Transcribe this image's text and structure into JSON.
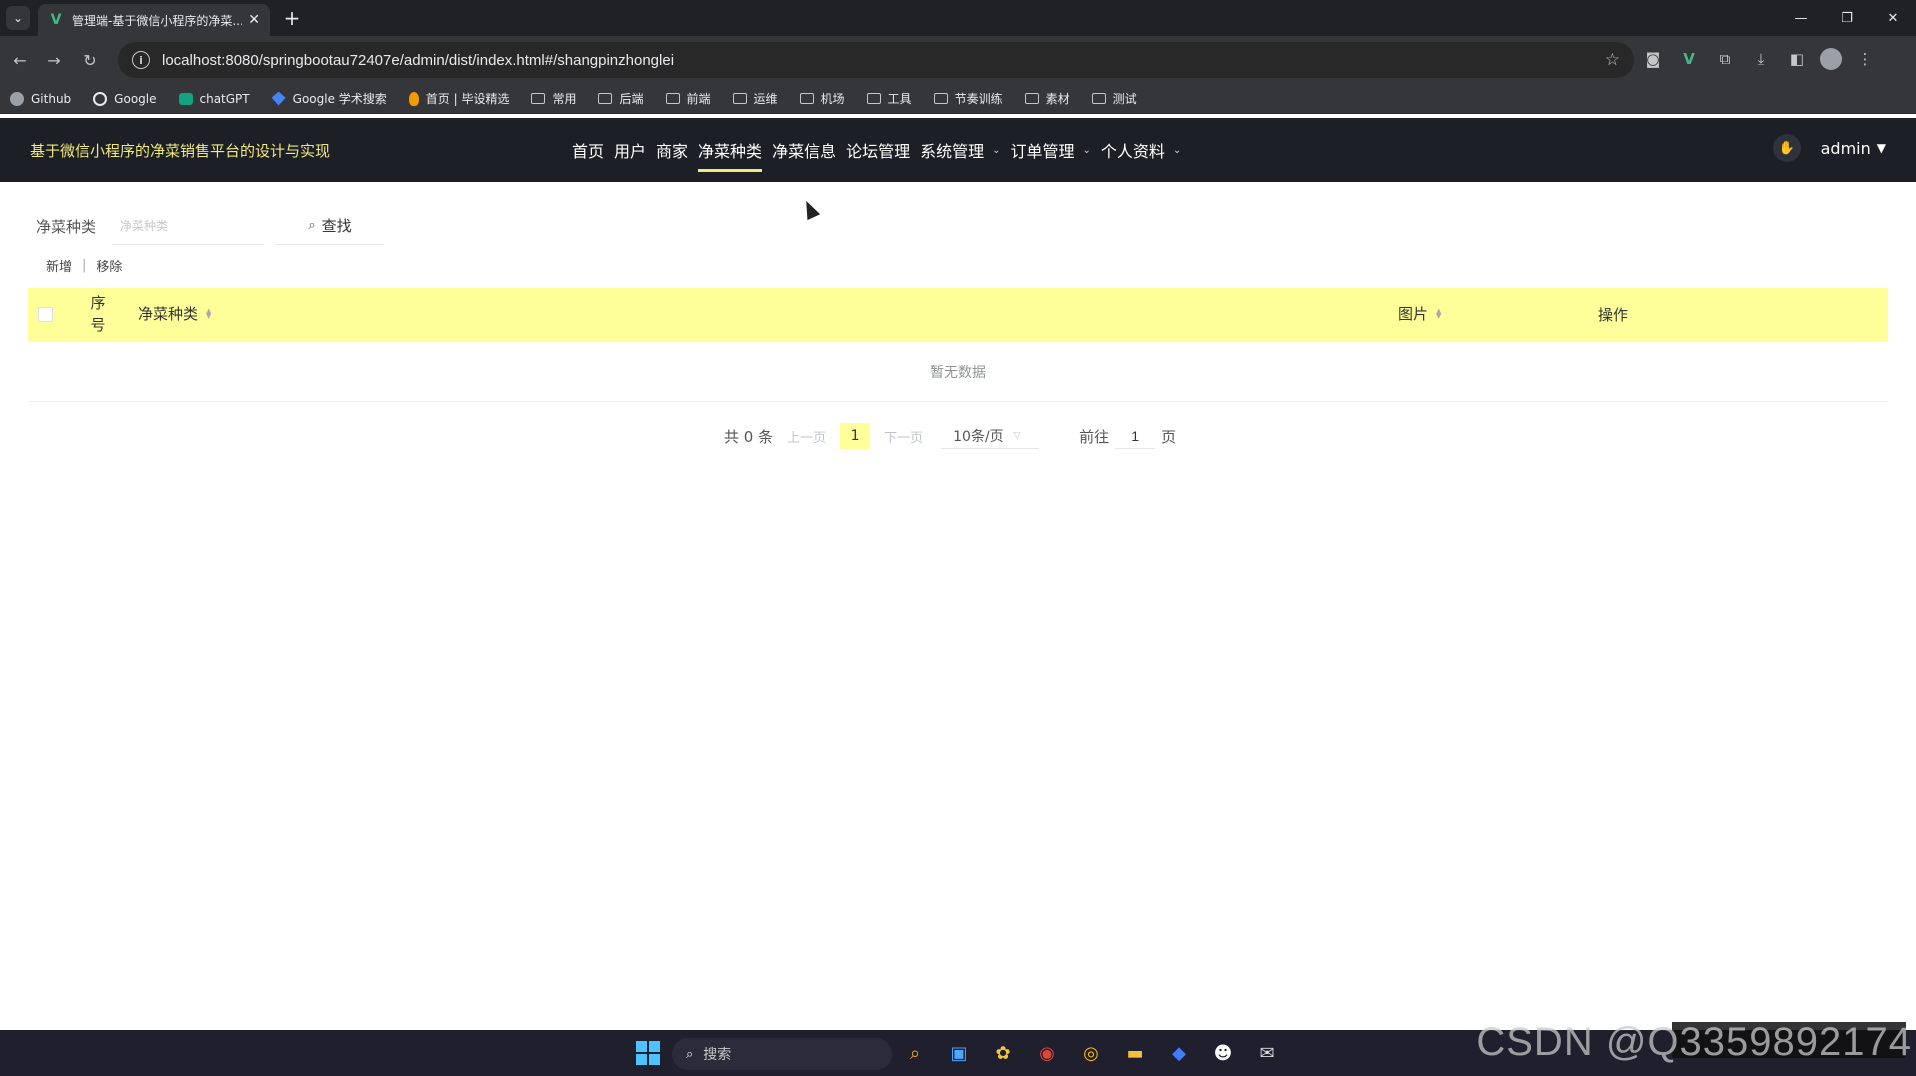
{
  "browser": {
    "tab_title": "管理端-基于微信小程序的净菜...",
    "tab_favicon": "V",
    "url": "localhost:8080/springbootau72407e/admin/dist/index.html#/shangpinzhonglei",
    "bookmarks": [
      {
        "label": "Github",
        "icon": "circle"
      },
      {
        "label": "Google",
        "icon": "g"
      },
      {
        "label": "chatGPT",
        "icon": "gpt"
      },
      {
        "label": "Google 学术搜索",
        "icon": "scholar"
      },
      {
        "label": "首页 | 毕设精选",
        "icon": "fire"
      },
      {
        "label": "常用",
        "icon": "folder"
      },
      {
        "label": "后端",
        "icon": "folder"
      },
      {
        "label": "前端",
        "icon": "folder"
      },
      {
        "label": "运维",
        "icon": "folder"
      },
      {
        "label": "机场",
        "icon": "folder"
      },
      {
        "label": "工具",
        "icon": "folder"
      },
      {
        "label": "节奏训练",
        "icon": "folder"
      },
      {
        "label": "素材",
        "icon": "folder"
      },
      {
        "label": "测试",
        "icon": "folder"
      }
    ]
  },
  "header": {
    "title": "基于微信小程序的净菜销售平台的设计与实现",
    "nav": [
      {
        "label": "首页",
        "active": false,
        "dropdown": false
      },
      {
        "label": "用户",
        "active": false,
        "dropdown": false
      },
      {
        "label": "商家",
        "active": false,
        "dropdown": false
      },
      {
        "label": "净菜种类",
        "active": true,
        "dropdown": false
      },
      {
        "label": "净菜信息",
        "active": false,
        "dropdown": false
      },
      {
        "label": "论坛管理",
        "active": false,
        "dropdown": false
      },
      {
        "label": "系统管理",
        "active": false,
        "dropdown": true
      },
      {
        "label": "订单管理",
        "active": false,
        "dropdown": true
      },
      {
        "label": "个人资料",
        "active": false,
        "dropdown": true
      }
    ],
    "user": "admin"
  },
  "search": {
    "label": "净菜种类",
    "placeholder": "净菜种类",
    "button": "查找"
  },
  "actions": {
    "add": "新增",
    "remove": "移除"
  },
  "table": {
    "columns": {
      "index_line1": "序",
      "index_line2": "号",
      "category": "净菜种类",
      "image": "图片",
      "operation": "操作"
    },
    "empty_text": "暂无数据",
    "header_color": "#ffff99"
  },
  "pagination": {
    "total": "共 0 条",
    "prev": "上一页",
    "current_page": "1",
    "next": "下一页",
    "page_size": "10条/页",
    "goto_prefix": "前往",
    "goto_value": "1",
    "goto_suffix": "页"
  },
  "taskbar": {
    "search_placeholder": "搜索"
  },
  "watermark": "CSDN @Q3359892174",
  "colors": {
    "header_bg": "#1c1f25",
    "accent": "#f1e97a",
    "table_header": "#ffff99"
  }
}
